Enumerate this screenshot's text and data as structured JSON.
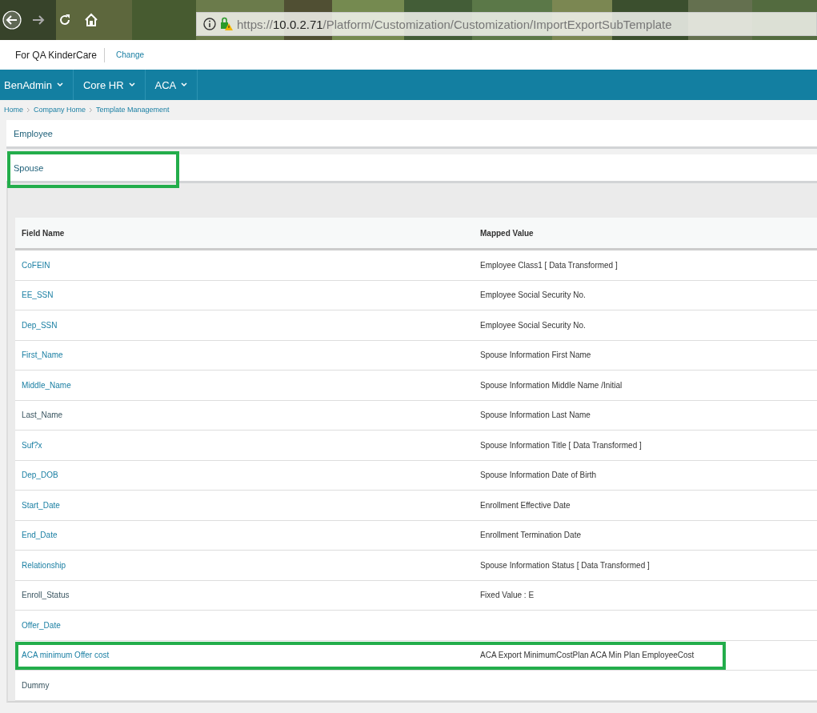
{
  "browser": {
    "url": {
      "scheme": "https://",
      "host": "10.0.2.71",
      "path": "/Platform/Customization/Customization/ImportExportSubTemplate"
    }
  },
  "header": {
    "company": "For QA KinderCare",
    "change_link": "Change"
  },
  "nav": [
    {
      "label": "BenAdmin"
    },
    {
      "label": "Core HR"
    },
    {
      "label": "ACA"
    }
  ],
  "breadcrumbs": [
    "Home",
    "Company Home",
    "Template Management"
  ],
  "sections": [
    {
      "title": "Employee",
      "expanded": false,
      "highlighted": false
    },
    {
      "title": "Spouse",
      "expanded": true,
      "highlighted": true
    }
  ],
  "table": {
    "columns": [
      "Field Name",
      "Mapped Value"
    ],
    "rows": [
      {
        "field": "CoFEIN",
        "mapped": "Employee Class1 [ Data Transformed ]",
        "linked": true,
        "highlighted": false
      },
      {
        "field": "EE_SSN",
        "mapped": "Employee Social Security No.",
        "linked": true,
        "highlighted": false
      },
      {
        "field": "Dep_SSN",
        "mapped": "Employee Social Security No.",
        "linked": true,
        "highlighted": false
      },
      {
        "field": "First_Name",
        "mapped": "Spouse Information First Name",
        "linked": true,
        "highlighted": false
      },
      {
        "field": "Middle_Name",
        "mapped": "Spouse Information Middle Name /Initial",
        "linked": true,
        "highlighted": false
      },
      {
        "field": "Last_Name",
        "mapped": "Spouse Information Last Name",
        "linked": false,
        "highlighted": false
      },
      {
        "field": "Suf?x",
        "mapped": "Spouse Information Title [ Data Transformed ]",
        "linked": true,
        "highlighted": false
      },
      {
        "field": "Dep_DOB",
        "mapped": "Spouse Information Date of Birth",
        "linked": true,
        "highlighted": false
      },
      {
        "field": "Start_Date",
        "mapped": "Enrollment Effective Date",
        "linked": true,
        "highlighted": false
      },
      {
        "field": "End_Date",
        "mapped": "Enrollment Termination Date",
        "linked": true,
        "highlighted": false
      },
      {
        "field": "Relationship",
        "mapped": "Spouse Information Status [ Data Transformed ]",
        "linked": true,
        "highlighted": false
      },
      {
        "field": "Enroll_Status",
        "mapped": "Fixed Value : E",
        "linked": false,
        "highlighted": false
      },
      {
        "field": "Offer_Date",
        "linked": true,
        "highlighted": false
      },
      {
        "field": "ACA minimum Offer cost",
        "mapped": "ACA Export MinimumCostPlan ACA Min Plan EmployeeCost",
        "linked": true,
        "highlighted": true
      },
      {
        "field": "Dummy",
        "linked": false,
        "highlighted": false
      }
    ]
  }
}
